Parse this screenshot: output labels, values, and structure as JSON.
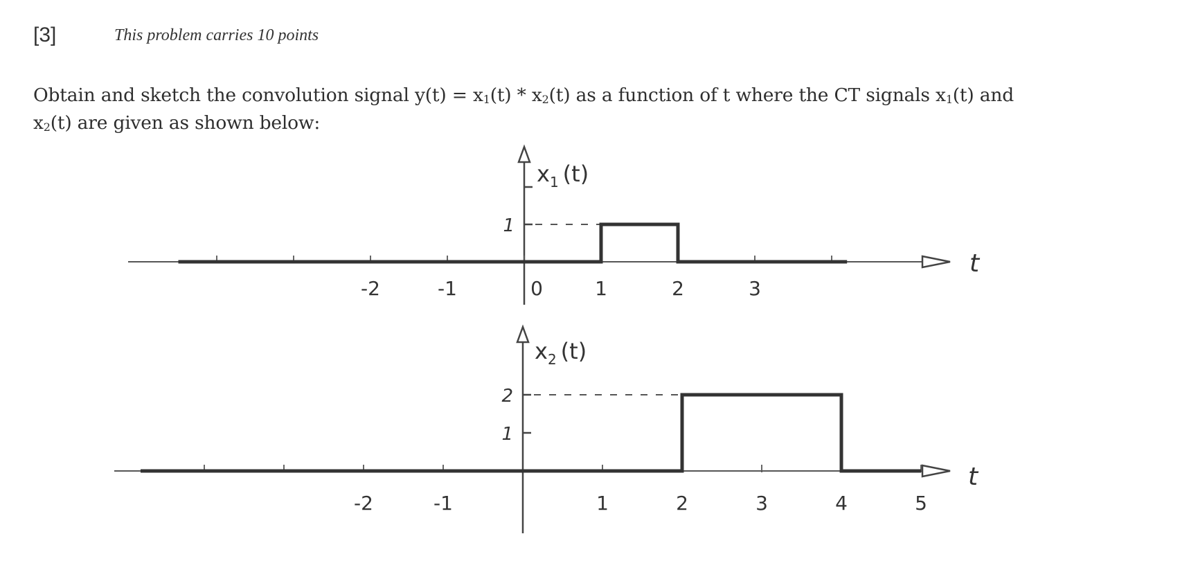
{
  "problem": {
    "number_label": "[3]",
    "points_note": "This problem carries 10 points",
    "statement": {
      "line1_prefix": "Obtain and sketch the convolution signal y(t) = x",
      "sub1": "1",
      "mid1": "(t) * x",
      "sub2": "2",
      "mid2": "(t) as a function of t where the CT signals x",
      "sub3": "1",
      "mid3": "(t) and",
      "line2_prefix": "x",
      "sub4": "2",
      "line2_suffix": "(t) are given as shown below:"
    }
  },
  "chart_data": [
    {
      "type": "line",
      "title": "x1(t)",
      "ylabel_main": "x",
      "ylabel_sub": "1",
      "ylabel_suffix": "(t)",
      "xlabel": "t",
      "x_ticks": [
        -4,
        -3,
        -2,
        -1,
        0,
        1,
        2,
        3,
        4
      ],
      "x_tick_labels": [
        {
          "value": -2,
          "label": "-2"
        },
        {
          "value": -1,
          "label": "-1"
        },
        {
          "value": 0,
          "label": "0"
        },
        {
          "value": 1,
          "label": "1"
        },
        {
          "value": 2,
          "label": "2"
        },
        {
          "value": 3,
          "label": "3"
        }
      ],
      "y_ticks": [
        {
          "value": 1,
          "label": "1"
        },
        {
          "value": 2,
          "label": ""
        }
      ],
      "xlim": [
        -4.8,
        5.5
      ],
      "ylim": [
        -0.5,
        2.8
      ],
      "signal": {
        "description": "Rectangular pulse of height 1 from t=1 to t=2",
        "points": [
          [
            -4.5,
            0
          ],
          [
            1,
            0
          ],
          [
            1,
            1
          ],
          [
            2,
            1
          ],
          [
            2,
            0
          ],
          [
            4.2,
            0
          ]
        ]
      },
      "dashed_guides": [
        {
          "from": [
            0,
            1
          ],
          "to": [
            1,
            1
          ]
        }
      ]
    },
    {
      "type": "line",
      "title": "x2(t)",
      "ylabel_main": "x",
      "ylabel_sub": "2",
      "ylabel_suffix": "(t)",
      "xlabel": "t",
      "x_ticks": [
        -4,
        -3,
        -2,
        -1,
        1,
        2,
        3,
        4,
        5
      ],
      "x_tick_labels": [
        {
          "value": -2,
          "label": "-2"
        },
        {
          "value": -1,
          "label": "-1"
        },
        {
          "value": 1,
          "label": "1"
        },
        {
          "value": 2,
          "label": "2"
        },
        {
          "value": 3,
          "label": "3"
        },
        {
          "value": 4,
          "label": "4"
        },
        {
          "value": 5,
          "label": "5"
        }
      ],
      "y_ticks": [
        {
          "value": 1,
          "label": "1"
        },
        {
          "value": 2,
          "label": "2"
        }
      ],
      "xlim": [
        -5.2,
        5.5
      ],
      "ylim": [
        -1.3,
        2.8
      ],
      "signal": {
        "description": "Rectangular pulse of height 2 from t=2 to t=4",
        "points": [
          [
            -4.8,
            0
          ],
          [
            2,
            0
          ],
          [
            2,
            2
          ],
          [
            4,
            2
          ],
          [
            4,
            0
          ],
          [
            5,
            0
          ]
        ]
      },
      "dashed_guides": [
        {
          "from": [
            0,
            2
          ],
          "to": [
            2,
            2
          ]
        }
      ]
    }
  ]
}
